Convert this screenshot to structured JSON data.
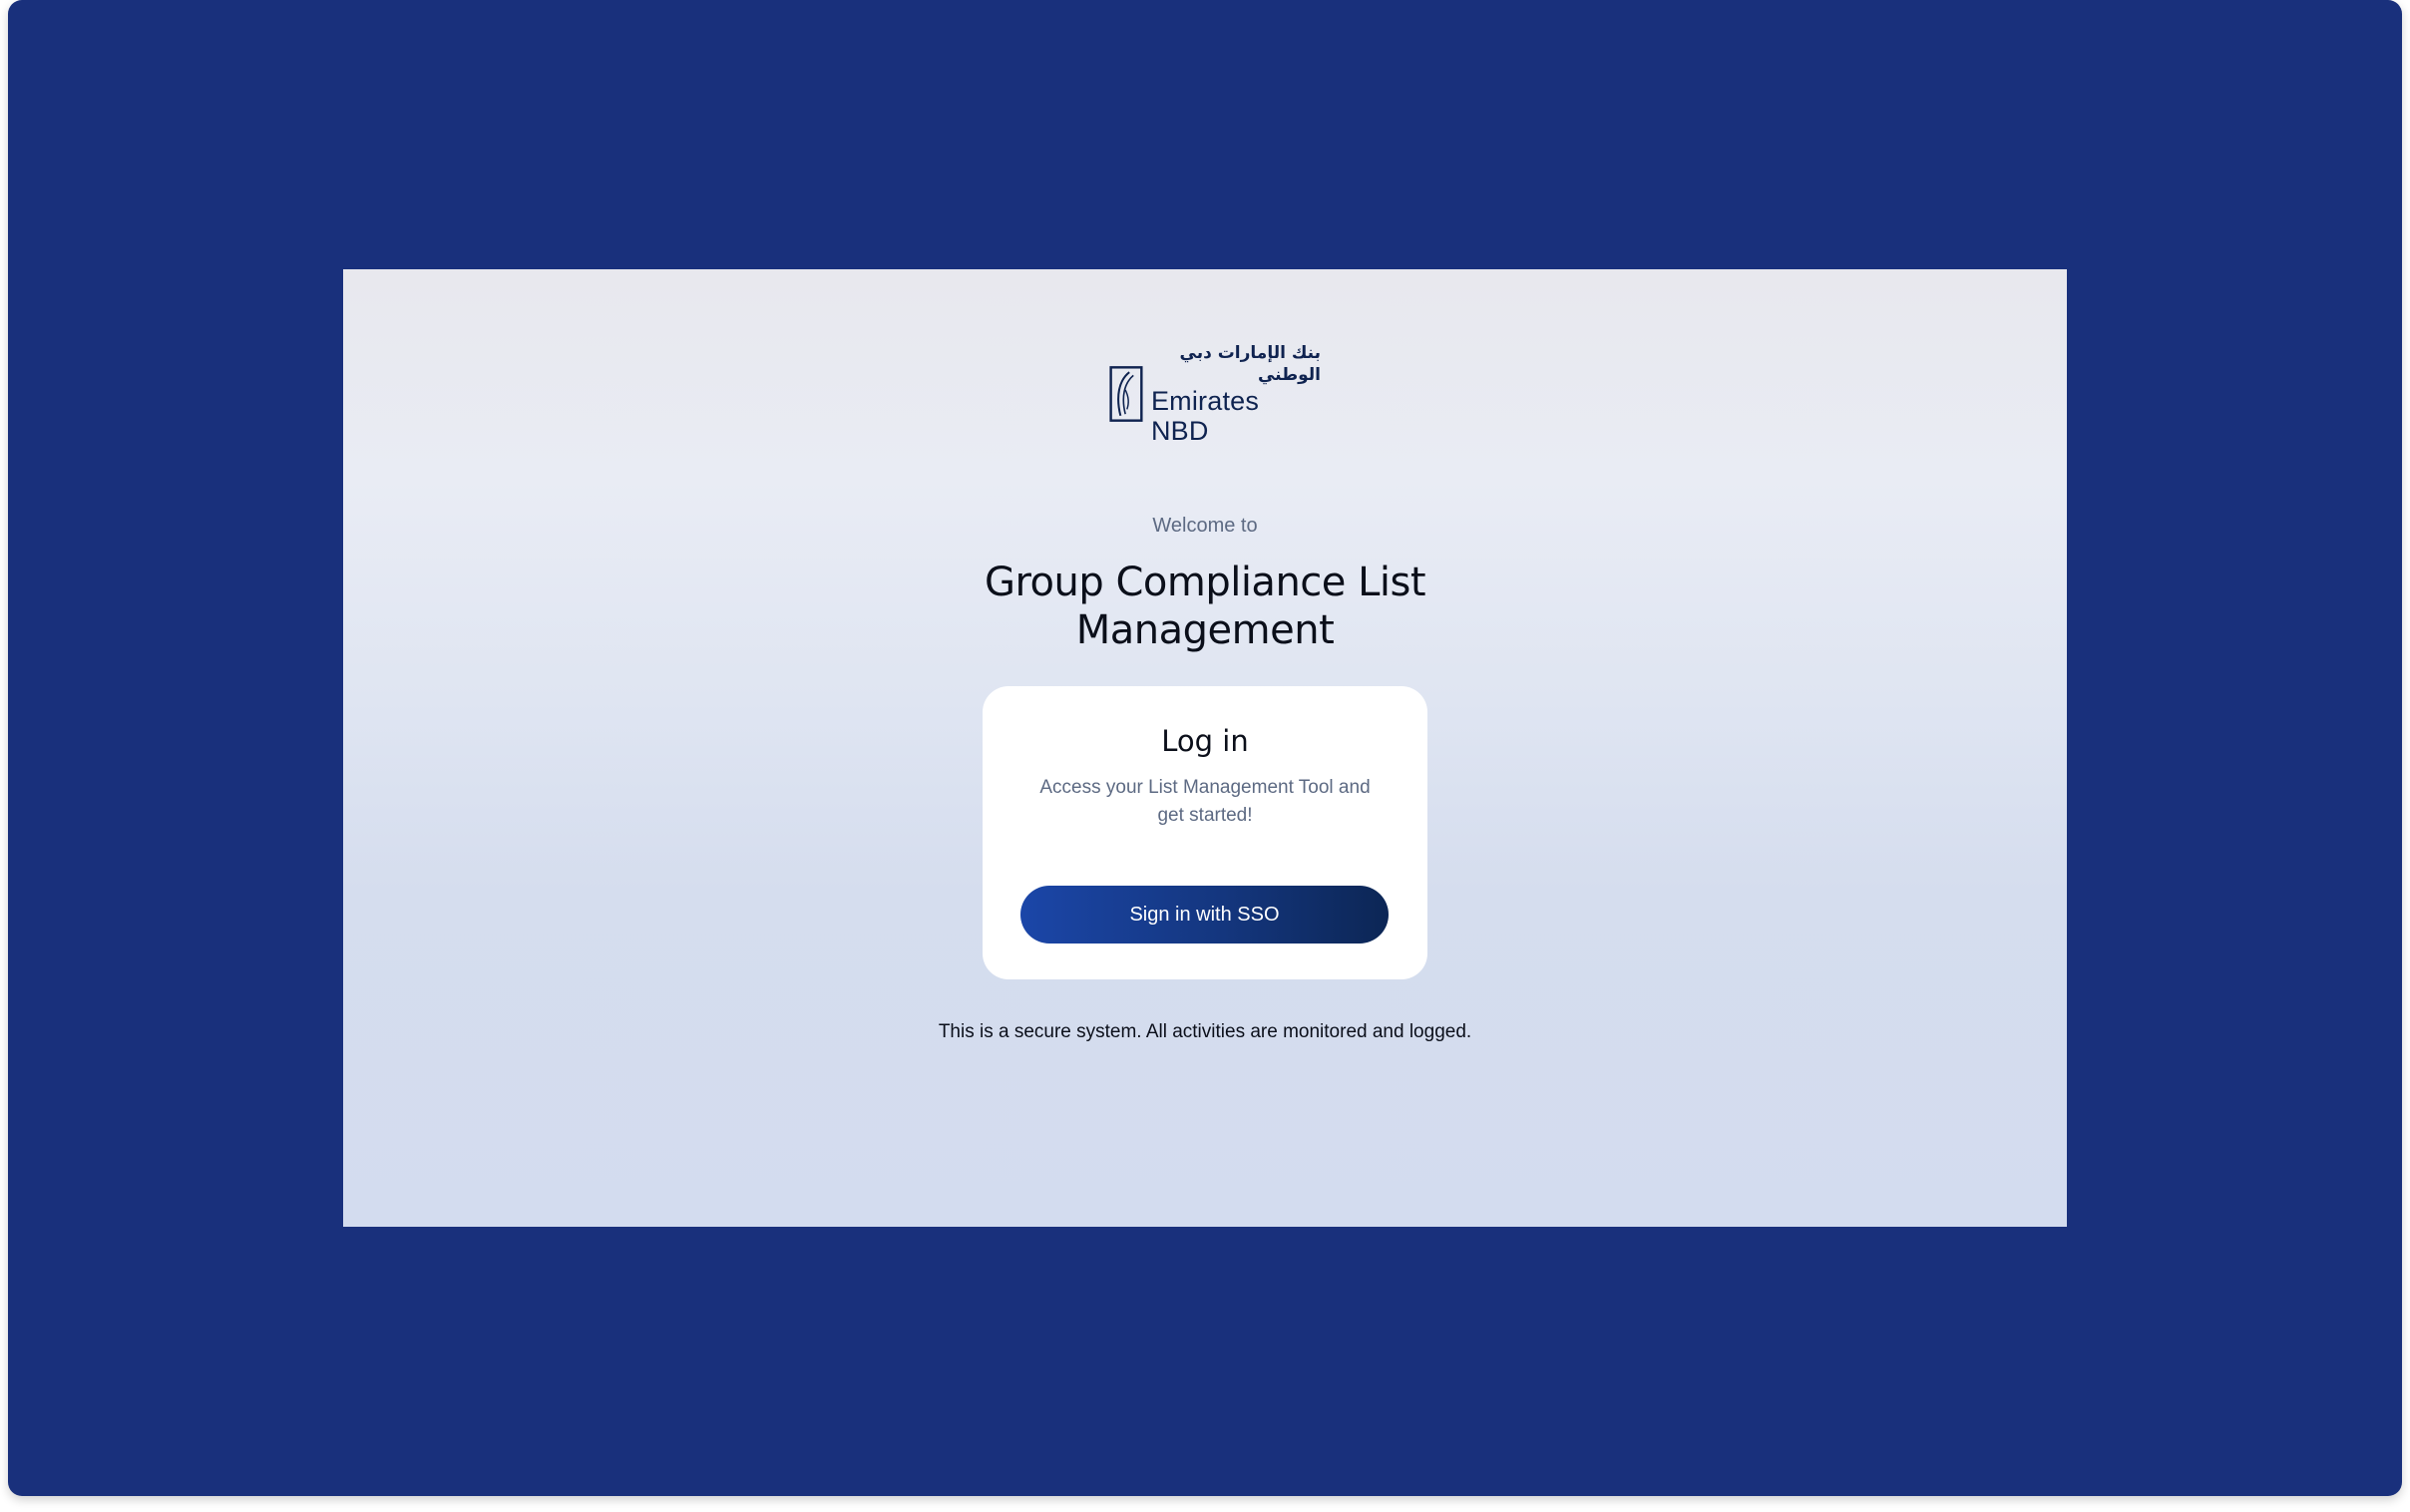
{
  "brand": {
    "arabic_name": "بنك الإمارات دبي الوطني",
    "english_name": "Emirates NBD",
    "color": "#0f2350"
  },
  "welcome": {
    "prefix": "Welcome to",
    "app_title": "Group Compliance List Management"
  },
  "login_card": {
    "title": "Log in",
    "subtitle": "Access your List Management Tool and get started!",
    "sso_button_label": "Sign in with SSO",
    "button_color": "#1b46a8"
  },
  "footer": {
    "notice": "This is a secure system. All activities are monitored and logged."
  },
  "colors": {
    "frame_background": "#19307c",
    "screen_background": "#dfe5f2",
    "card_background": "#ffffff"
  }
}
